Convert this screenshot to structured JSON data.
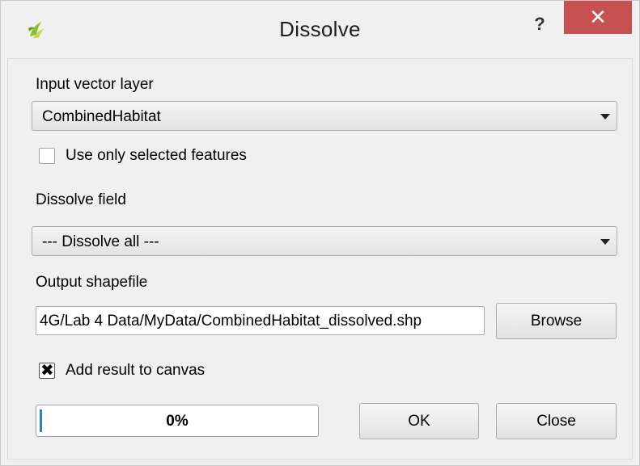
{
  "window": {
    "title": "Dissolve",
    "help_label": "?",
    "close_label": "✕",
    "app_icon": "qgis-icon"
  },
  "form": {
    "input_layer_label": "Input vector layer",
    "input_layer_value": "CombinedHabitat",
    "use_selected_label": "Use only selected features",
    "use_selected_checked": false,
    "dissolve_field_label": "Dissolve field",
    "dissolve_field_value": "--- Dissolve all ---",
    "output_label": "Output shapefile",
    "output_value": "4G/Lab 4 Data/MyData/CombinedHabitat_dissolved.shp",
    "browse_label": "Browse",
    "add_result_label": "Add result to canvas",
    "add_result_checked": true,
    "checkmark": "✖"
  },
  "progress": {
    "value": 0,
    "text": "0%"
  },
  "buttons": {
    "ok_label": "OK",
    "close_label": "Close"
  },
  "colors": {
    "close_button": "#c75050",
    "progress_fill": "#2a7fd4"
  }
}
